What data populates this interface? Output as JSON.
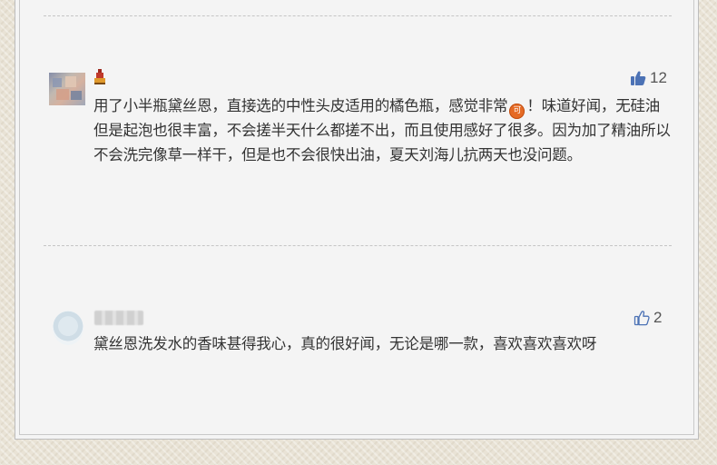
{
  "comments": [
    {
      "likes": "12",
      "text_before_emoji": "用了小半瓶黛丝恩，直接选的中性头皮适用的橘色瓶，感觉非常",
      "emoji_label": "可",
      "text_after_emoji": "！味道好闻，无硅油但是起泡也很丰富，不会搓半天什么都搓不出，而且使用感好了很多。因为加了精油所以不会洗完像草一样干，但是也不会很快出油，夏天刘海儿抗两天也没问题。"
    },
    {
      "likes": "2",
      "text": "黛丝恩洗发水的香味甚得我心，真的很好闻，无论是哪一款，喜欢喜欢喜欢呀"
    }
  ],
  "colors": {
    "like_filled": "#4c72b5",
    "like_outline": "#4c72b5",
    "emoji_bg": "#e56a24"
  },
  "icons": {
    "like_filled": "thumbs-up-filled-icon",
    "like_outline": "thumbs-up-outline-icon",
    "badge": "user-level-badge-icon"
  }
}
